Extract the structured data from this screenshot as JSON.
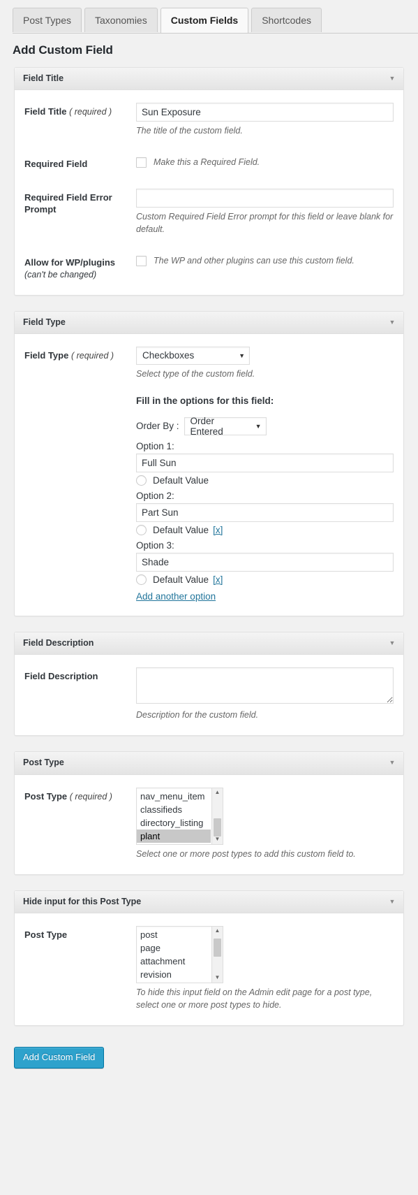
{
  "tabs": [
    {
      "label": "Post Types",
      "active": false
    },
    {
      "label": "Taxonomies",
      "active": false
    },
    {
      "label": "Custom Fields",
      "active": true
    },
    {
      "label": "Shortcodes",
      "active": false
    }
  ],
  "page_title": "Add Custom Field",
  "colors": {
    "accent_link": "#21759b",
    "primary_button": "#2ea2cc",
    "primary_button_border": "#0074a2",
    "panel_header_bg": "#e4e4e4",
    "selected_row": "#c8c8c8"
  },
  "panels": {
    "field_title": {
      "header": "Field Title",
      "toggle_icon": "chevron-down-icon",
      "rows": {
        "field_title": {
          "label": "Field Title",
          "required_note": "( required )",
          "value": "Sun Exposure",
          "placeholder": "",
          "hint": "The title of the custom field."
        },
        "required_field": {
          "label": "Required Field",
          "checkbox_label": "Make this a Required Field.",
          "checked": false
        },
        "error_prompt": {
          "label": "Required Field Error Prompt",
          "value": "",
          "placeholder": "",
          "hint": "Custom Required Field Error prompt for this field or leave blank for default."
        },
        "allow_wp": {
          "label": "Allow for WP/plugins",
          "sub_label": "(can't be changed)",
          "checkbox_label": "The WP and other plugins can use this custom field.",
          "checked": false
        }
      }
    },
    "field_type": {
      "header": "Field Type",
      "toggle_icon": "chevron-down-icon",
      "label": "Field Type",
      "required_note": "( required )",
      "selected": "Checkboxes",
      "caret": "▼",
      "hint": "Select type of the custom field.",
      "options_heading": "Fill in the options for this field:",
      "order_by_label": "Order By :",
      "order_by_selected": "Order Entered",
      "default_value_label": "Default Value",
      "remove_link": "[x]",
      "add_option_link": "Add another option",
      "options": [
        {
          "label": "Option 1:",
          "value": "Full Sun",
          "is_default": false,
          "removable": false
        },
        {
          "label": "Option 2:",
          "value": "Part Sun",
          "is_default": false,
          "removable": true
        },
        {
          "label": "Option 3:",
          "value": "Shade",
          "is_default": false,
          "removable": true
        }
      ]
    },
    "field_description": {
      "header": "Field Description",
      "toggle_icon": "chevron-down-icon",
      "label": "Field Description",
      "value": "",
      "placeholder": "",
      "hint": "Description for the custom field."
    },
    "post_type": {
      "header": "Post Type",
      "toggle_icon": "chevron-down-icon",
      "label": "Post Type",
      "required_note": "( required )",
      "hint": "Select one or more post types to add this custom field to.",
      "items": [
        {
          "label": "nav_menu_item",
          "selected": false
        },
        {
          "label": "classifieds",
          "selected": false
        },
        {
          "label": "directory_listing",
          "selected": false
        },
        {
          "label": "plant",
          "selected": true
        }
      ],
      "scroll_up_icon": "triangle-up-icon",
      "scroll_down_icon": "triangle-down-icon"
    },
    "hide_post_type": {
      "header": "Hide input for this Post Type",
      "toggle_icon": "chevron-down-icon",
      "label": "Post Type",
      "hint": "To hide this input field on the Admin edit page for a post type, select one or more post types to hide.",
      "items": [
        {
          "label": "post",
          "selected": false
        },
        {
          "label": "page",
          "selected": false
        },
        {
          "label": "attachment",
          "selected": false
        },
        {
          "label": "revision",
          "selected": false
        }
      ],
      "scroll_up_icon": "triangle-up-icon",
      "scroll_down_icon": "triangle-down-icon"
    }
  },
  "submit": {
    "label": "Add Custom Field"
  }
}
